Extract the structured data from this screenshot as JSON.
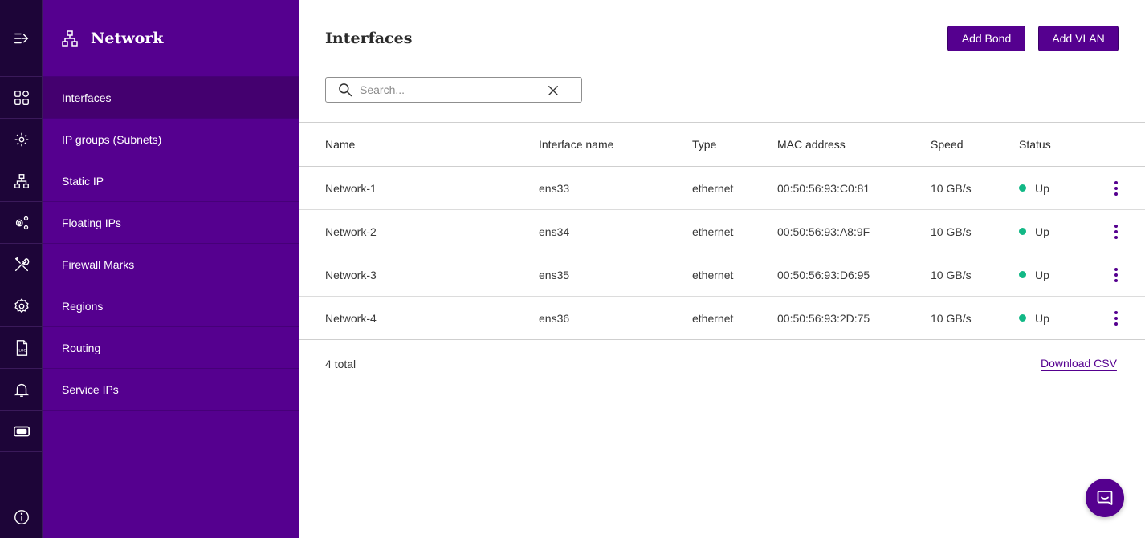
{
  "menu": {
    "title": "Network",
    "items": [
      {
        "label": "Interfaces",
        "icon": "dashboard-grid-icon",
        "active": true
      },
      {
        "label": "IP groups (Subnets)",
        "icon": "gear-nodes-icon"
      },
      {
        "label": "Static IP",
        "icon": "network-icon"
      },
      {
        "label": "Floating IPs",
        "icon": "gears-icon"
      },
      {
        "label": "Firewall Marks",
        "icon": "tools-icon"
      },
      {
        "label": "Regions",
        "icon": "gear-icon"
      },
      {
        "label": "Routing",
        "icon": "log-file-icon"
      },
      {
        "label": "Service IPs",
        "icon": "bell-icon"
      }
    ]
  },
  "page": {
    "title": "Interfaces",
    "add_bond": "Add Bond",
    "add_vlan": "Add VLAN"
  },
  "search": {
    "placeholder": "Search...",
    "value": ""
  },
  "table": {
    "columns": [
      "Name",
      "Interface name",
      "Type",
      "MAC address",
      "Speed",
      "Status"
    ],
    "rows": [
      {
        "name": "Network-1",
        "interface": "ens33",
        "type": "ethernet",
        "mac": "00:50:56:93:C0:81",
        "speed": "10 GB/s",
        "status": "Up"
      },
      {
        "name": "Network-2",
        "interface": "ens34",
        "type": "ethernet",
        "mac": "00:50:56:93:A8:9F",
        "speed": "10 GB/s",
        "status": "Up"
      },
      {
        "name": "Network-3",
        "interface": "ens35",
        "type": "ethernet",
        "mac": "00:50:56:93:D6:95",
        "speed": "10 GB/s",
        "status": "Up"
      },
      {
        "name": "Network-4",
        "interface": "ens36",
        "type": "ethernet",
        "mac": "00:50:56:93:2D:75",
        "speed": "10 GB/s",
        "status": "Up"
      }
    ]
  },
  "footer": {
    "total": "4 total",
    "download": "Download CSV"
  },
  "colors": {
    "brand": "#55008f",
    "rail": "#1d0538",
    "status_up": "#12b886"
  }
}
